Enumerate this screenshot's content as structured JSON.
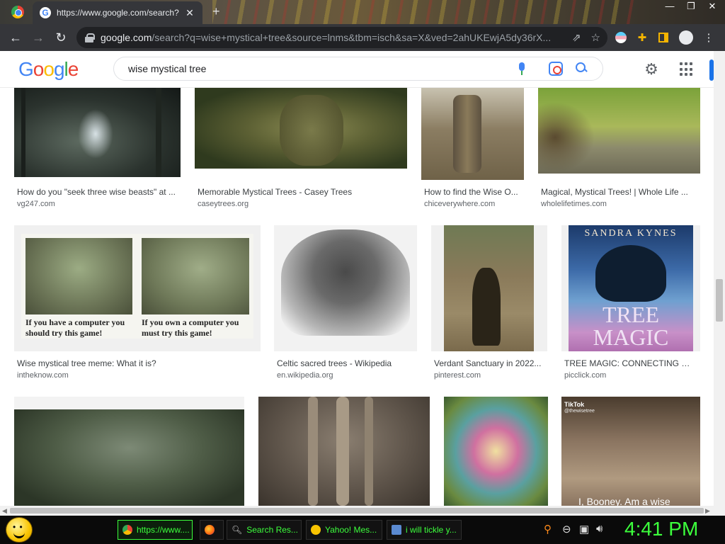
{
  "browser": {
    "tab_title": "https://www.google.com/search?",
    "tab_close": "✕",
    "new_tab": "+",
    "window_controls": [
      "—",
      "❐",
      "✕"
    ],
    "back": "←",
    "forward": "→",
    "reload": "↻",
    "url_host": "google.com",
    "url_path": "/search?q=wise+mystical+tree&source=lnms&tbm=isch&sa=X&ved=2ahUKEwjA5dy36rX..."
  },
  "google": {
    "logo_letters": [
      "G",
      "o",
      "o",
      "g",
      "l",
      "e"
    ],
    "query": "wise mystical tree"
  },
  "results": {
    "row1": [
      {
        "caption": "How do you \"seek three wise beasts\" at ...",
        "domain": "vg247.com"
      },
      {
        "caption": "Memorable Mystical Trees - Casey Trees",
        "domain": "caseytrees.org"
      },
      {
        "caption": "How to find the Wise O...",
        "domain": "chiceverywhere.com"
      },
      {
        "caption": "Magical, Mystical Trees! | Whole Life ...",
        "domain": "wholelifetimes.com"
      }
    ],
    "row2": [
      {
        "caption": "Wise mystical tree meme: What it is?",
        "domain": "intheknow.com",
        "meme_left": "If you have a computer you should try this game!",
        "meme_right": "If you own a computer you must try this game!"
      },
      {
        "caption": "Celtic sacred trees - Wikipedia",
        "domain": "en.wikipedia.org"
      },
      {
        "caption": "Verdant Sanctuary in 2022...",
        "domain": "pinterest.com"
      },
      {
        "caption": "TREE MAGIC: CONNECTING Wit...",
        "domain": "picclick.com",
        "book_author": "SANDRA KYNES",
        "book_title_1": "TREE",
        "book_title_2": "MAGIC"
      }
    ],
    "row3_overlays": {
      "tiktok_label": "TikTok",
      "tiktok_handle": "@thewisetree",
      "tiktok_text": "I, Booney. Am a wise"
    }
  },
  "taskbar": {
    "buttons": [
      {
        "label": "https://www...."
      },
      {
        "label": ""
      },
      {
        "label": "Search Res..."
      },
      {
        "label": "Yahoo! Mes..."
      },
      {
        "label": "i will tickle y..."
      }
    ],
    "clock": "4:41 PM"
  }
}
